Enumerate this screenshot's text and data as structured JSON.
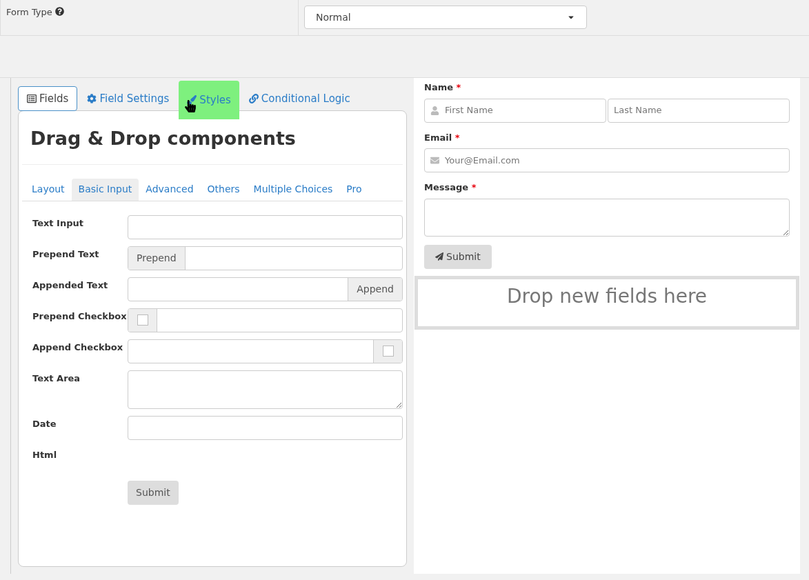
{
  "form_type": {
    "label": "Form Type",
    "value": "Normal"
  },
  "builder_tabs": [
    {
      "label": "Fields",
      "selected": true,
      "hovered": false
    },
    {
      "label": "Field Settings",
      "selected": false,
      "hovered": false
    },
    {
      "label": "Styles",
      "selected": false,
      "hovered": true
    },
    {
      "label": "Conditional Logic",
      "selected": false,
      "hovered": false
    }
  ],
  "components": {
    "title": "Drag & Drop components",
    "tabs": [
      {
        "label": "Layout",
        "selected": false
      },
      {
        "label": "Basic Input",
        "selected": true
      },
      {
        "label": "Advanced",
        "selected": false
      },
      {
        "label": "Others",
        "selected": false
      },
      {
        "label": "Multiple Choices",
        "selected": false
      },
      {
        "label": "Pro",
        "selected": false
      }
    ],
    "items": [
      {
        "kind": "text",
        "label": "Text Input"
      },
      {
        "kind": "prepend",
        "label": "Prepend Text",
        "addon": "Prepend"
      },
      {
        "kind": "append",
        "label": "Appended Text",
        "addon": "Append"
      },
      {
        "kind": "prepend-checkbox",
        "label": "Prepend Checkbox",
        "checked": false
      },
      {
        "kind": "append-checkbox",
        "label": "Append Checkbox",
        "checked": false
      },
      {
        "kind": "textarea",
        "label": "Text Area"
      },
      {
        "kind": "text",
        "label": "Date"
      },
      {
        "kind": "html",
        "label": "Html"
      },
      {
        "kind": "submit",
        "label": "Submit"
      }
    ]
  },
  "form_preview": {
    "fields": [
      {
        "kind": "name",
        "label": "Name",
        "required_mark": "*",
        "placeholders": [
          "First Name",
          "Last Name"
        ]
      },
      {
        "kind": "email",
        "label": "Email",
        "required_mark": "*",
        "placeholders": [
          "Your@Email.com"
        ]
      },
      {
        "kind": "textarea",
        "label": "Message",
        "required_mark": "*"
      }
    ],
    "submit": "Submit",
    "drop_zone": "Drop new fields here"
  }
}
